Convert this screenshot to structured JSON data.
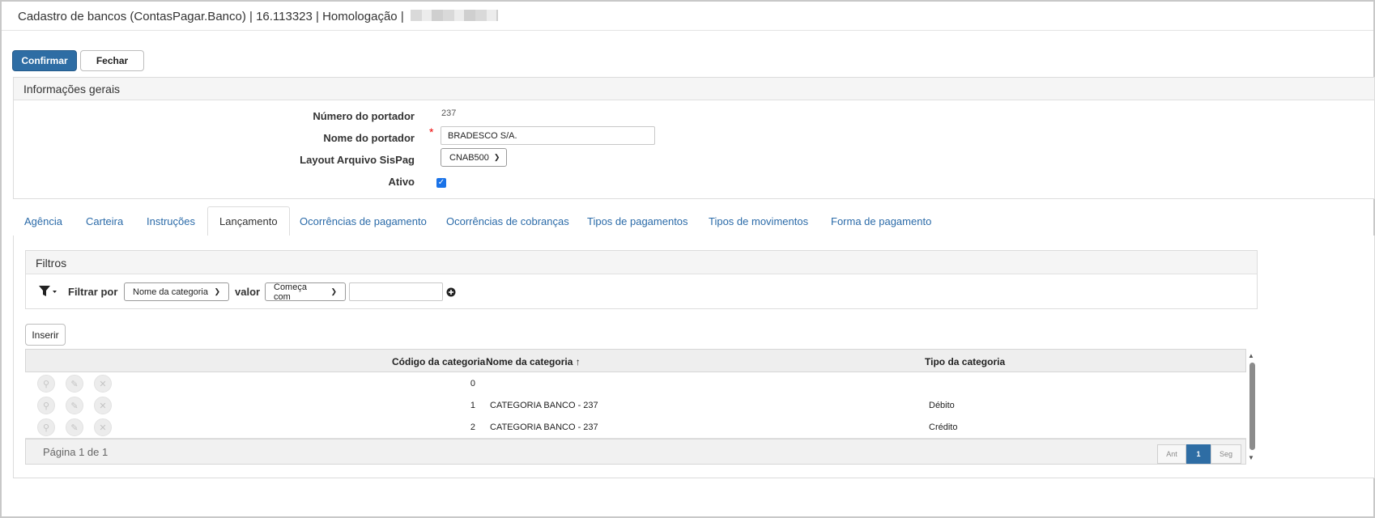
{
  "window": {
    "title": "Cadastro de bancos (ContasPagar.Banco) | 16.113323 | Homologação |"
  },
  "toolbar": {
    "confirm_label": "Confirmar",
    "close_label": "Fechar"
  },
  "general": {
    "header": "Informações gerais",
    "fields": {
      "numero_label": "Número do portador",
      "numero_value": "237",
      "nome_label": "Nome do portador",
      "nome_value": "BRADESCO S/A.",
      "required_mark": "*",
      "layout_label": "Layout Arquivo SisPag",
      "layout_value": "CNAB500",
      "ativo_label": "Ativo",
      "ativo_checked": true
    }
  },
  "tabs": [
    {
      "label": "Agência"
    },
    {
      "label": "Carteira"
    },
    {
      "label": "Instruções"
    },
    {
      "label": "Lançamento",
      "active": true
    },
    {
      "label": "Ocorrências de pagamento"
    },
    {
      "label": "Ocorrências de cobranças"
    },
    {
      "label": "Tipos de pagamentos"
    },
    {
      "label": "Tipos de movimentos"
    },
    {
      "label": "Forma de pagamento"
    }
  ],
  "filters": {
    "header": "Filtros",
    "filter_by_label": "Filtrar por",
    "field_select": "Nome da categoria",
    "value_label": "valor",
    "operator_select": "Começa com",
    "value_input": ""
  },
  "grid": {
    "insert_label": "Inserir",
    "columns": [
      "Código da categoria",
      "Nome da categoria",
      "Tipo da categoria"
    ],
    "sort_indicator": "↑",
    "rows": [
      {
        "codigo": "0",
        "nome": "",
        "tipo": ""
      },
      {
        "codigo": "1",
        "nome": "CATEGORIA BANCO - 237",
        "tipo": "Débito"
      },
      {
        "codigo": "2",
        "nome": "CATEGORIA BANCO - 237",
        "tipo": "Crédito"
      }
    ],
    "footer": {
      "page_info": "Página 1 de 1",
      "prev_label": "Ant",
      "current_page": "1",
      "next_label": "Seg"
    }
  },
  "colors": {
    "primary": "#2e6da4",
    "link": "#2a6aa8",
    "required": "#ee0000",
    "checkbox": "#1a73e8"
  },
  "icons": {
    "filter": "filter-icon",
    "add": "plus-circle-icon",
    "view": "magnifier-icon",
    "edit": "pencil-icon",
    "delete": "close-icon",
    "sort": "arrow-up-icon"
  }
}
